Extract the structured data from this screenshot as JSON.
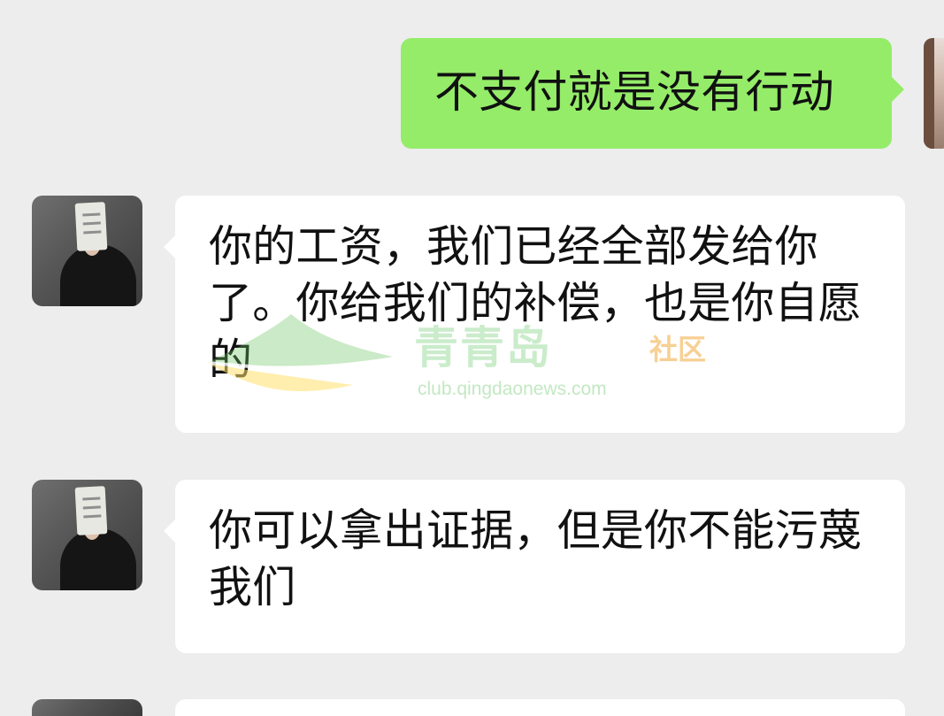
{
  "conversation": {
    "messages": [
      {
        "sender": "self",
        "text": "不支付就是没有行动"
      },
      {
        "sender": "contact",
        "text": "你的工资，我们已经全部发给你了。你给我们的补偿，也是你自愿的"
      },
      {
        "sender": "contact",
        "text": "你可以拿出证据，但是你不能污蔑我们"
      }
    ]
  },
  "watermark": {
    "title": "青青岛",
    "subtitle": "社区",
    "url": "club.qingdaonews.com"
  },
  "colors": {
    "background": "#ededed",
    "self_bubble": "#95ec69",
    "contact_bubble": "#ffffff",
    "text": "#111111"
  },
  "icons": {
    "contact_avatar": "avatar-photo",
    "self_avatar": "avatar-photo"
  }
}
